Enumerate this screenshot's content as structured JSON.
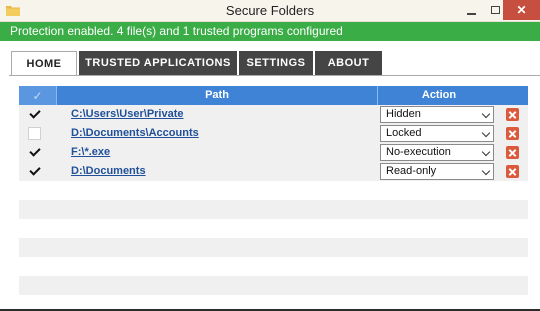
{
  "window": {
    "title": "Secure Folders",
    "close_glyph": "✕"
  },
  "status": {
    "text": "Protection enabled. 4 file(s) and 1 trusted programs configured",
    "color": "#3aad47"
  },
  "tabs": [
    {
      "label": "HOME",
      "active": true
    },
    {
      "label": "TRUSTED APPLICATIONS",
      "active": false
    },
    {
      "label": "SETTINGS",
      "active": false
    },
    {
      "label": "ABOUT",
      "active": false
    }
  ],
  "table": {
    "header_check_glyph": "✓",
    "columns": {
      "path": "Path",
      "action": "Action"
    },
    "rows": [
      {
        "checked": true,
        "path": "C:\\Users\\User\\Private",
        "action": "Hidden"
      },
      {
        "checked": false,
        "path": "D:\\Documents\\Accounts",
        "action": "Locked"
      },
      {
        "checked": true,
        "path": "F:\\*.exe",
        "action": "No-execution"
      },
      {
        "checked": true,
        "path": "D:\\Documents",
        "action": "Read-only"
      }
    ]
  },
  "colors": {
    "header_blue": "#3f83d6",
    "link_blue": "#1f5099",
    "delete_red": "#dc5a3c",
    "tab_dark": "#454545"
  }
}
